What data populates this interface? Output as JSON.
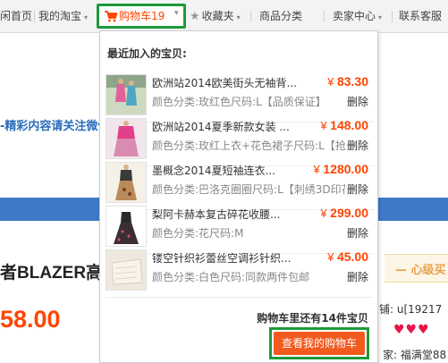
{
  "topbar": {
    "home": "闲首页",
    "my_taobao": "我的淘宝",
    "cart": "购物车19",
    "favorites": "收藏夹",
    "categories": "商品分类",
    "seller_center": "卖家中心",
    "support": "联系客服"
  },
  "background": {
    "promo": "-精彩内容请关注微信",
    "title_fragment": "者BLAZER高帮",
    "price_fragment": "58.00",
    "vip_banner": "— 心级买",
    "shop_line": "铺: u[19217",
    "hearts": "♥♥♥",
    "seller_line": "家: 福满堂88"
  },
  "cart_dropdown": {
    "title": "最近加入的宝贝:",
    "items": [
      {
        "name": "欧洲站2014欧美街头无袖背...",
        "currency": "¥",
        "price": "83.30",
        "spec": "颜色分类:玫红色尺码:L【品质保证】",
        "remove": "删除"
      },
      {
        "name": "欧洲站2014夏季新款女装 ...",
        "currency": "¥",
        "price": "148.00",
        "spec": "颜色分类:玫红上衣+花色裙子尺码:L【抢",
        "remove": "删除"
      },
      {
        "name": "墨概念2014夏短袖连衣...",
        "currency": "¥",
        "price": "1280.00",
        "spec": "颜色分类:巴洛克圈圈尺码:L【刺绣3D印花",
        "remove": "删除"
      },
      {
        "name": "梨阿卡赫本复古碎花收腰...",
        "currency": "¥",
        "price": "299.00",
        "spec": "颜色分类:花尺码:M",
        "remove": "删除"
      },
      {
        "name": "镂空针织衫蕾丝空调衫针织...",
        "currency": "¥",
        "price": "45.00",
        "spec": "颜色分类:白色尺码:同款两件包邮",
        "remove": "删除"
      }
    ],
    "remaining": "购物车里还有14件宝贝",
    "checkout_label": "查看我的购物车"
  },
  "colors": {
    "accent": "#ff4400",
    "highlight_border": "#1d9a3b",
    "checkout_button": "#f25a1e",
    "link_blue": "#2b6dbb"
  },
  "icons": {
    "cart": "cart-icon",
    "star": "star-icon",
    "caret": "caret-down-icon"
  }
}
